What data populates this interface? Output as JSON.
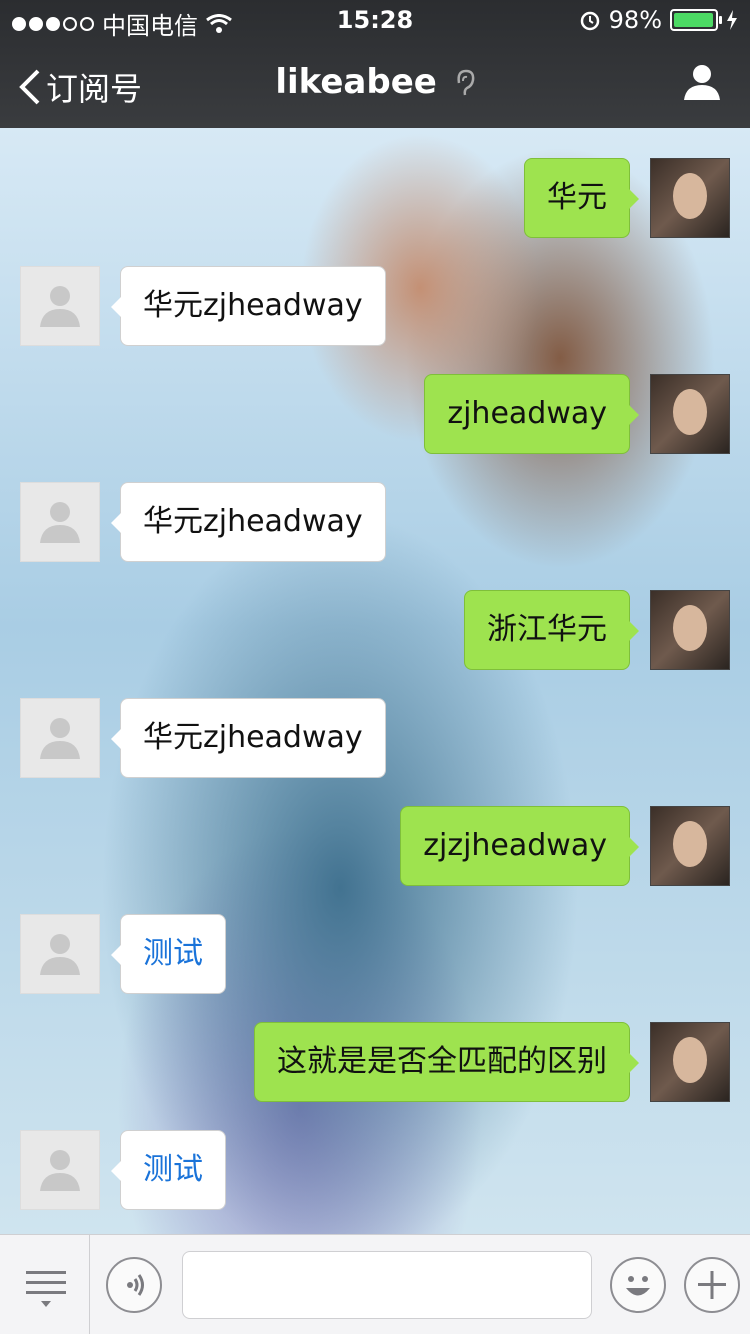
{
  "status": {
    "carrier": "中国电信",
    "time": "15:28",
    "battery": "98%",
    "battery_level": 0.98
  },
  "nav": {
    "back_label": "订阅号",
    "title": "likeabee"
  },
  "messages": [
    {
      "from": "me",
      "text": "华元"
    },
    {
      "from": "other",
      "text": "华元zjheadway"
    },
    {
      "from": "me",
      "text": "zjheadway"
    },
    {
      "from": "other",
      "text": "华元zjheadway"
    },
    {
      "from": "me",
      "text": "浙江华元"
    },
    {
      "from": "other",
      "text": "华元zjheadway"
    },
    {
      "from": "me",
      "text": "zjzjheadway"
    },
    {
      "from": "other",
      "text": "测试"
    },
    {
      "from": "me",
      "text": "这就是是否全匹配的区别"
    },
    {
      "from": "other",
      "text": "测试"
    }
  ],
  "input": {
    "placeholder": ""
  },
  "icons": {
    "menu": "list-menu-icon",
    "voice": "voice-icon",
    "emoji": "emoji-icon",
    "plus": "plus-icon",
    "back": "chevron-left-icon",
    "profile": "user-icon",
    "ear": "ear-icon",
    "wifi": "wifi-icon",
    "alarm": "alarm-icon",
    "charging": "charging-icon"
  },
  "colors": {
    "me_bubble": "#9ee34f",
    "link": "#1a73d9",
    "battery": "#4cd964"
  }
}
